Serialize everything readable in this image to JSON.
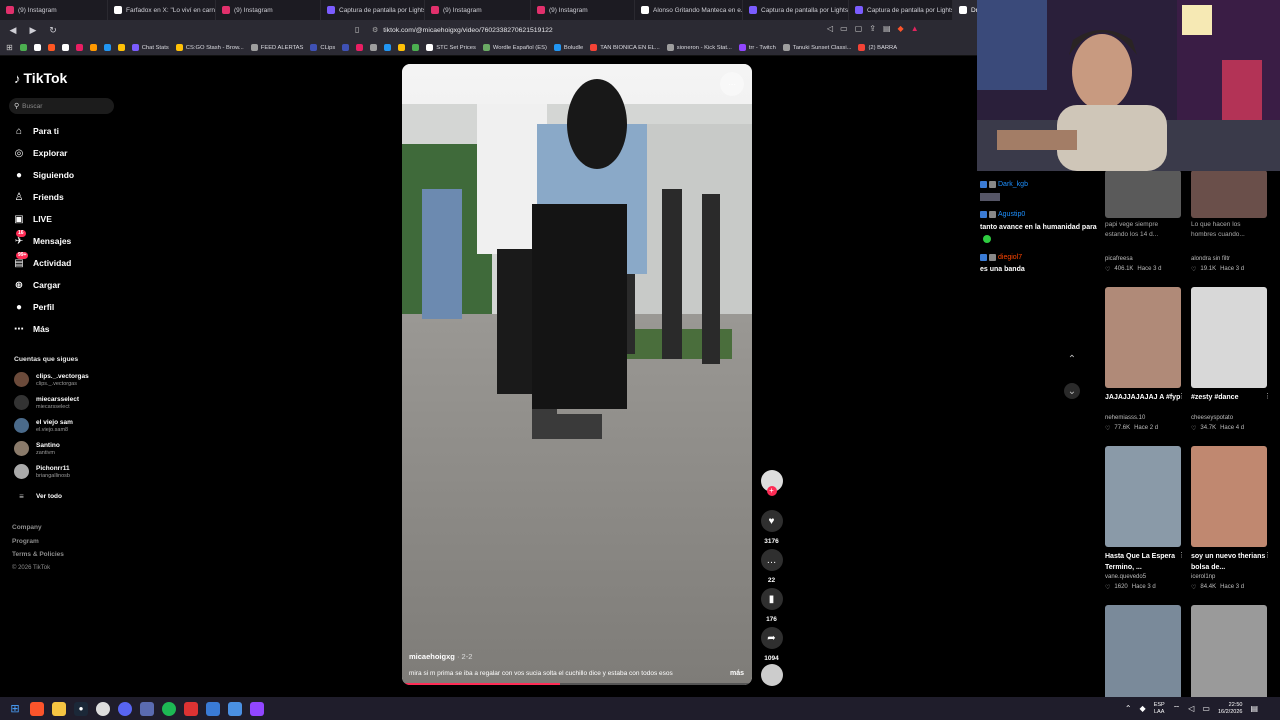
{
  "browser": {
    "tabs": [
      {
        "label": "(9) Instagram",
        "color": "#e1306c"
      },
      {
        "label": "Farfadox en X: \"Lo viví en carne...",
        "color": "#ffffff"
      },
      {
        "label": "(9) Instagram",
        "color": "#e1306c"
      },
      {
        "label": "Captura de pantalla por Lightsh...",
        "color": "#7b5cff"
      },
      {
        "label": "(9) Instagram",
        "color": "#e1306c"
      },
      {
        "label": "(9) Instagram",
        "color": "#e1306c"
      },
      {
        "label": "Alonso Gritando Manteca en e...",
        "color": "#ffffff"
      },
      {
        "label": "Captura de pantalla por Lightsh...",
        "color": "#7b5cff"
      },
      {
        "label": "Captura de pantalla por Lightsh...",
        "color": "#7b5cff"
      },
      {
        "label": "Drama y traición entre...",
        "color": "#ffffff",
        "active": true
      }
    ],
    "url": "tiktok.com/@micaehoigxg/video/7602338270621519122",
    "bookmarks": [
      {
        "label": "",
        "color": "#4caf50"
      },
      {
        "label": "",
        "color": "#ffffff"
      },
      {
        "label": "",
        "color": "#ff5722"
      },
      {
        "label": "",
        "color": "#ffffff"
      },
      {
        "label": "",
        "color": "#e91e63"
      },
      {
        "label": "",
        "color": "#ff9800"
      },
      {
        "label": "",
        "color": "#2196f3"
      },
      {
        "label": "",
        "color": "#ffc107"
      },
      {
        "label": "Chat Stats",
        "color": "#7b5cff"
      },
      {
        "label": "CS:GO Stash - Brow...",
        "color": "#ffc107"
      },
      {
        "label": "FEED ALERTAS",
        "color": "#9e9e9e"
      },
      {
        "label": "CLips",
        "color": "#3f51b5"
      },
      {
        "label": "",
        "color": "#3f51b5"
      },
      {
        "label": "",
        "color": "#e91e63"
      },
      {
        "label": "",
        "color": "#9e9e9e"
      },
      {
        "label": "",
        "color": "#2196f3"
      },
      {
        "label": "",
        "color": "#ffc107"
      },
      {
        "label": "",
        "color": "#4caf50"
      },
      {
        "label": "STC Set Prices",
        "color": "#ffffff"
      },
      {
        "label": "Wordle Español (ES)",
        "color": "#6aaa64"
      },
      {
        "label": "Boludle",
        "color": "#2196f3"
      },
      {
        "label": "TAN BIONICA EN EL...",
        "color": "#f44336"
      },
      {
        "label": "sioneron - Kick Stat...",
        "color": "#9e9e9e"
      },
      {
        "label": "trr - Twitch",
        "color": "#9146ff"
      },
      {
        "label": "Tanuki Sunset Classi...",
        "color": "#9e9e9e"
      },
      {
        "label": "(2) BARRA",
        "color": "#f44336"
      }
    ]
  },
  "tiktok": {
    "logo": "TikTok",
    "search_placeholder": "Buscar",
    "nav": [
      {
        "label": "Para ti",
        "icon": "home-icon",
        "glyph": "⌂"
      },
      {
        "label": "Explorar",
        "icon": "compass-icon",
        "glyph": "◎"
      },
      {
        "label": "Siguiendo",
        "icon": "following-icon",
        "glyph": "●"
      },
      {
        "label": "Friends",
        "icon": "friends-icon",
        "glyph": "♙"
      },
      {
        "label": "LIVE",
        "icon": "live-icon",
        "glyph": "▣"
      },
      {
        "label": "Mensajes",
        "icon": "messages-icon",
        "glyph": "✈",
        "badge": "16"
      },
      {
        "label": "Actividad",
        "icon": "activity-icon",
        "glyph": "▤",
        "badge": "99+"
      },
      {
        "label": "Cargar",
        "icon": "upload-icon",
        "glyph": "⊕"
      },
      {
        "label": "Perfil",
        "icon": "profile-icon",
        "glyph": "●"
      },
      {
        "label": "Más",
        "icon": "more-icon",
        "glyph": "⋯"
      }
    ],
    "following_title": "Cuentas que sigues",
    "following": [
      {
        "name": "clips._.vectorgas",
        "handle": "clips._.vectorgas",
        "color": "#6b4a3a"
      },
      {
        "name": "miecarsselect",
        "handle": "miecarsselect",
        "color": "#333333"
      },
      {
        "name": "el viejo sam",
        "handle": "el.viejo.sam8",
        "color": "#4a6a8a"
      },
      {
        "name": "Santino",
        "handle": "zantivm",
        "color": "#8a7a6a"
      },
      {
        "name": "Pichonrr11",
        "handle": "briangallinosb",
        "color": "#aaaaaa"
      }
    ],
    "see_all": "Ver todo",
    "footer": [
      "Company",
      "Program",
      "Terms & Policies",
      "© 2026 TikTok"
    ],
    "video": {
      "username": "micaehoigxg",
      "date": "· 2-2",
      "caption": "mira si m prima se iba a regalar con vos sucia solta el cuchillo dice y estaba con todos esos",
      "more": "más",
      "progress": 0.45
    },
    "actions": [
      {
        "name": "like",
        "icon": "heart-icon",
        "glyph": "♥",
        "count": "3176"
      },
      {
        "name": "comment",
        "icon": "comment-icon",
        "glyph": "…",
        "count": "22"
      },
      {
        "name": "save",
        "icon": "bookmark-icon",
        "glyph": "▮",
        "count": "176"
      },
      {
        "name": "share",
        "icon": "share-icon",
        "glyph": "➦",
        "count": "1094"
      }
    ],
    "recommended": [
      {
        "title": "papi vege siempre estando los 14 d...",
        "user": "picafreesa",
        "likes": "406.1K",
        "age": "Hace 3 d",
        "color": "#5a5a5a"
      },
      {
        "title": "Lo que hacen los hombres cuando...",
        "user": "alondra sin filtr",
        "likes": "19.1K",
        "age": "Hace 3 d",
        "color": "#6a4f4a"
      },
      {
        "title": "JAJAJJAJAJAJ A #fyp",
        "user": "nehemiasss.10",
        "likes": "77.6K",
        "age": "Hace 2 d",
        "color": "#b08a78"
      },
      {
        "title": "#zesty #dance",
        "user": "cheeseyspotato",
        "likes": "34.7K",
        "age": "Hace 4 d",
        "color": "#d8d8d8"
      },
      {
        "title": "Hasta Que La Espera Termino, ...",
        "user": "vane.quevedo5",
        "likes": "1620",
        "age": "Hace 3 d",
        "color": "#8a9aa8"
      },
      {
        "title": "soy un nuevo therians bolsa de...",
        "user": "icerol1np",
        "likes": "84.4K",
        "age": "Hace 3 d",
        "color": "#c08870"
      },
      {
        "title": "",
        "user": "",
        "likes": "",
        "age": "",
        "color": "#7a8a9a"
      },
      {
        "title": "",
        "user": "",
        "likes": "",
        "age": "",
        "color": "#9a9a9a"
      }
    ]
  },
  "chat": {
    "messages": [
      {
        "user": "Dark_kgb",
        "color": "#1e90ff",
        "text": ""
      },
      {
        "user": "Agustip0",
        "color": "#1e90ff",
        "text": "tanto avance en la humanidad para que uno tenga que vivir en este país de mierda"
      },
      {
        "user": "diegiol7",
        "color": "#ff4500",
        "text": "es una banda"
      }
    ]
  },
  "taskbar": {
    "lang": "ESP",
    "region": "LAA",
    "time": "22:50",
    "date": "16/2/2026"
  },
  "colors": {
    "accent": "#fe2c55",
    "tiktok_cyan": "#25f4ee"
  }
}
